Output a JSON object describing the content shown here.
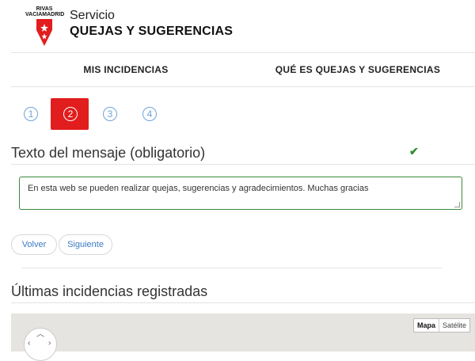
{
  "header": {
    "logo_text_line1": "RIVAS",
    "logo_text_line2": "VACIAMADRID",
    "service_label": "Servicio",
    "service_title": "QUEJAS Y SUGERENCIAS"
  },
  "nav": {
    "tab_my_incidents": "MIS INCIDENCIAS",
    "tab_what_is": "QUÉ ES QUEJAS Y SUGERENCIAS"
  },
  "steps": [
    {
      "label": "1",
      "active": false
    },
    {
      "label": "2",
      "active": true
    },
    {
      "label": "3",
      "active": false
    },
    {
      "label": "4",
      "active": false
    }
  ],
  "form": {
    "message_label": "Texto del mensaje (obligatorio)",
    "message_value": "En esta web se pueden realizar quejas, sugerencias y agradecimientos. Muchas gracias",
    "valid_icon": "✔"
  },
  "buttons": {
    "back": "Volver",
    "next": "Siguiente"
  },
  "recent": {
    "title": "Últimas incidencias registradas"
  },
  "map": {
    "type_map": "Mapa",
    "type_satellite": "Satélite"
  },
  "colors": {
    "brand_red": "#e11d1d",
    "link_blue": "#3a7cc2",
    "valid_green": "#3c8a3c"
  }
}
